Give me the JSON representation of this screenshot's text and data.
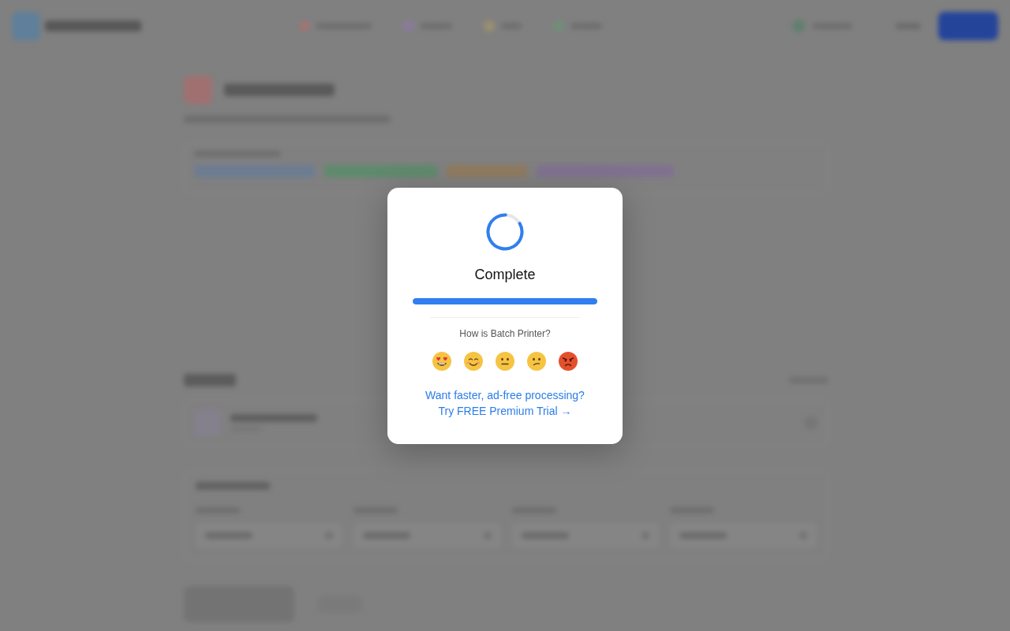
{
  "dialog": {
    "status": "Complete",
    "progress": {
      "level": 1
    },
    "rating_prompt": "How is Batch Printer?",
    "ratings": [
      {
        "kind": "heart_eyes"
      },
      {
        "kind": "smiling"
      },
      {
        "kind": "neutral"
      },
      {
        "kind": "confused"
      },
      {
        "kind": "angry"
      }
    ],
    "upsell": {
      "text": "Want faster, ad-free processing?",
      "link": "Try FREE Premium Trial →"
    }
  }
}
